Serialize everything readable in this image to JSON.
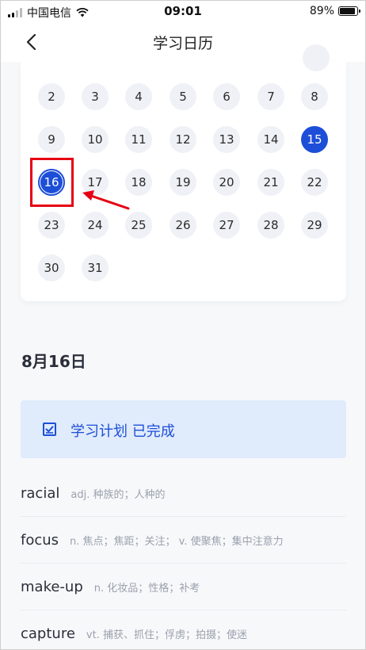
{
  "status_bar": {
    "carrier": "中国电信",
    "time": "09:01",
    "battery": "89%",
    "battery_level": 0.89
  },
  "nav": {
    "title": "学习日历"
  },
  "calendar": {
    "days": [
      "2",
      "3",
      "4",
      "5",
      "6",
      "7",
      "8",
      "9",
      "10",
      "11",
      "12",
      "13",
      "14",
      "15",
      "16",
      "17",
      "18",
      "19",
      "20",
      "21",
      "22",
      "23",
      "24",
      "25",
      "26",
      "27",
      "28",
      "29",
      "30",
      "31"
    ],
    "selected_day": "15",
    "current_day": "16"
  },
  "selected_date": "8月16日",
  "plan": {
    "label": "学习计划 已完成",
    "completed": true
  },
  "words": [
    {
      "word": "racial",
      "meaning": "adj. 种族的；人种的"
    },
    {
      "word": "focus",
      "meaning": "n. 焦点；焦距；关注； v. 使聚焦；集中注意力"
    },
    {
      "word": "make-up",
      "meaning": "n. 化妆品；性格；补考"
    },
    {
      "word": "capture",
      "meaning": "vt. 捕获、抓住；俘虏；拍摄；使迷"
    }
  ],
  "colors": {
    "accent": "#1d4ed8",
    "annotation": "#e60012",
    "plan_bg": "#e0ebfc"
  }
}
